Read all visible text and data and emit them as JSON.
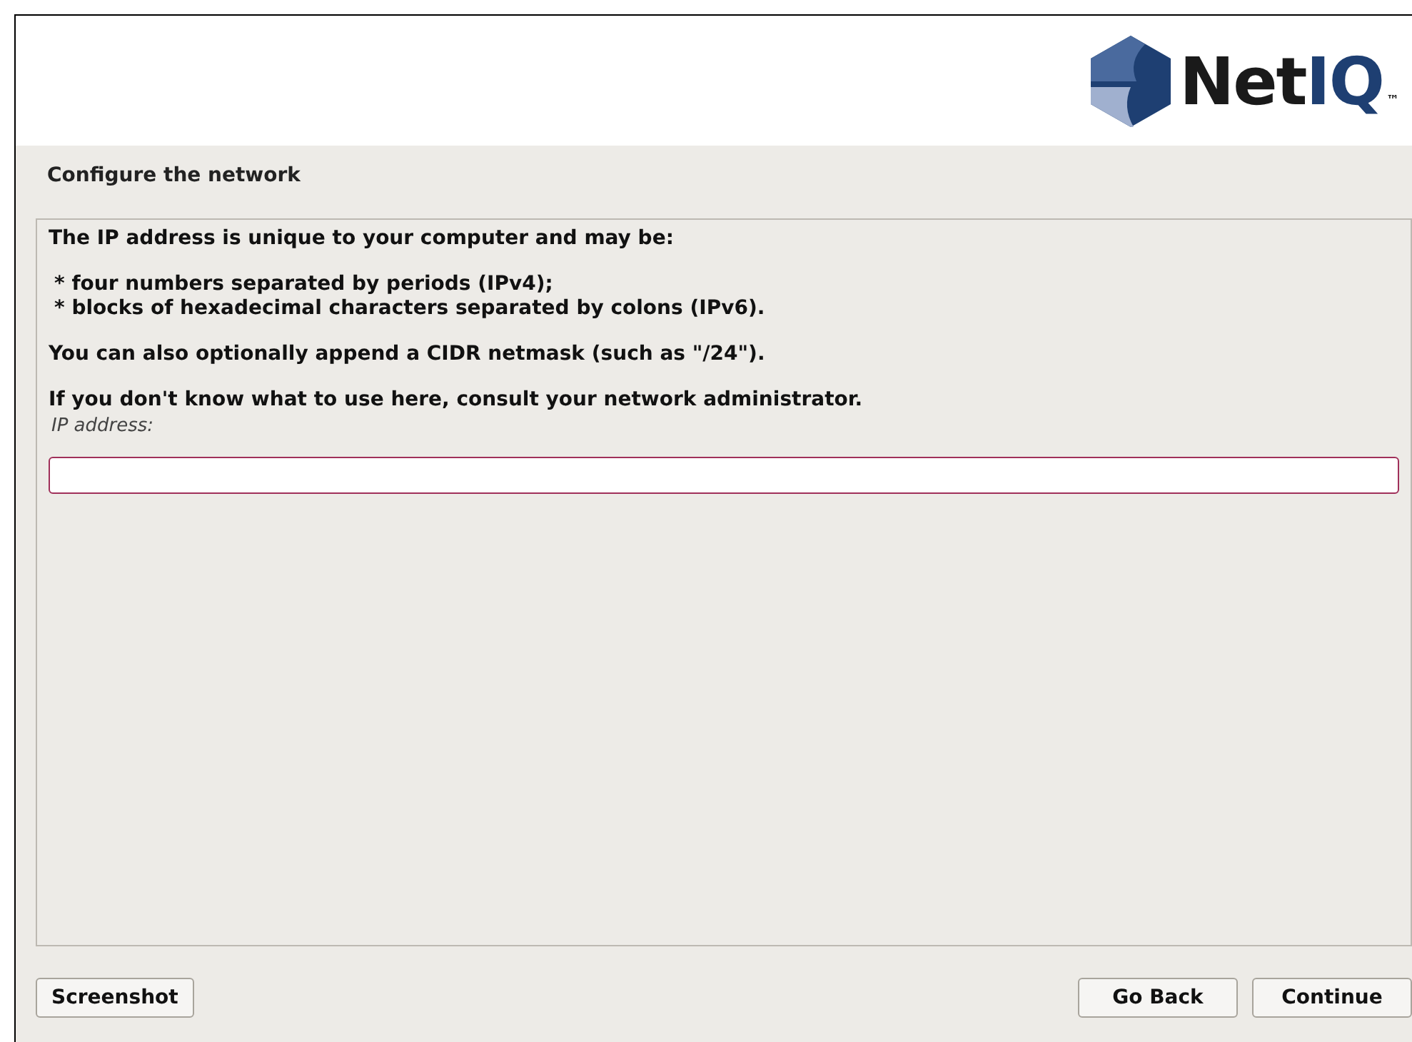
{
  "header": {
    "logo": {
      "text": "Net",
      "accent": "IQ",
      "mark": "™"
    }
  },
  "title": "Configure the network",
  "paragraphs": [
    {
      "kind": "text",
      "lines": [
        "The IP address is unique to your computer and may be:"
      ]
    },
    {
      "kind": "bullets",
      "lines": [
        "* four numbers separated by periods (IPv4);",
        "* blocks of hexadecimal characters separated by colons (IPv6)."
      ]
    },
    {
      "kind": "text",
      "lines": [
        "You can also optionally append a CIDR netmask (such as \"/24\")."
      ]
    },
    {
      "kind": "text",
      "lines": [
        "If you don't know what to use here, consult your network administrator."
      ]
    }
  ],
  "field": {
    "label": "IP address:"
  },
  "buttons": {
    "left": [
      "Screenshot"
    ],
    "right": [
      "Go Back",
      "Continue"
    ]
  }
}
